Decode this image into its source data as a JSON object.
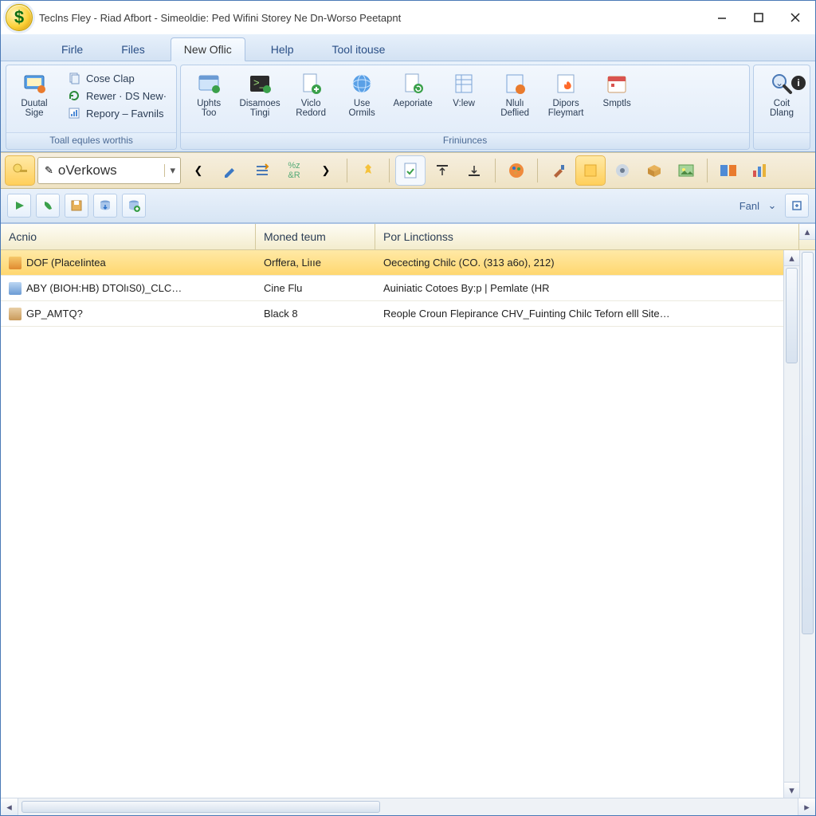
{
  "window": {
    "title": "Teclns Fley - Riad Afbort - Simeoldie: Ped Wifini Storey Ne Dn-Worso Peetapnt"
  },
  "menu": {
    "tabs": [
      "Firle",
      "Files",
      "New Oflic",
      "Help",
      "Tool itouse"
    ],
    "active_index": 2
  },
  "ribbon": {
    "group1": {
      "big": {
        "label": "Duutal\nSige"
      },
      "rows": [
        {
          "label": "Cose Clap"
        },
        {
          "label": "Rewer  ·  DS New·"
        },
        {
          "label": "Repory  –  Favnils"
        }
      ],
      "caption": "Toall equles worthis"
    },
    "group2": {
      "buttons": [
        {
          "label": "Uphts\nToo"
        },
        {
          "label": "Disamoes\nTingi"
        },
        {
          "label": "Viclo\nRedord"
        },
        {
          "label": "Use\nOrmils"
        },
        {
          "label": "Aeporiate"
        },
        {
          "label": "V:lew"
        },
        {
          "label": "Nlulı\nDeflied"
        },
        {
          "label": "Dipors\nFleymart"
        },
        {
          "label": "Smptls"
        }
      ],
      "caption": "Friniunces"
    },
    "group3": {
      "big": {
        "label": "Coit\nDlang"
      }
    }
  },
  "toolbar": {
    "selector": {
      "value": "oVerkows"
    }
  },
  "subbar": {
    "right_label": "Fanl"
  },
  "grid": {
    "columns": [
      "Acnio",
      "Moned teum",
      "Por Linctionss"
    ],
    "rows": [
      {
        "a": "DOF (PlaceIintea",
        "b": "Orffera, Liııe",
        "c": "Oececting Chilc (CO. (313 a6o), 212)",
        "selected": true
      },
      {
        "a": "ABY (BIOH:HB) DTOlıS0)_CLC…",
        "b": "Cine Flu",
        "c": "Auiniatic Cotoes By:p | Pemlate (HR",
        "selected": false
      },
      {
        "a": "GP_AMTQ?",
        "b": "Black 8",
        "c": "Reople Croun Flepirance CHV_Fuinting Chilc Teforn elll Site…",
        "selected": false
      }
    ]
  }
}
